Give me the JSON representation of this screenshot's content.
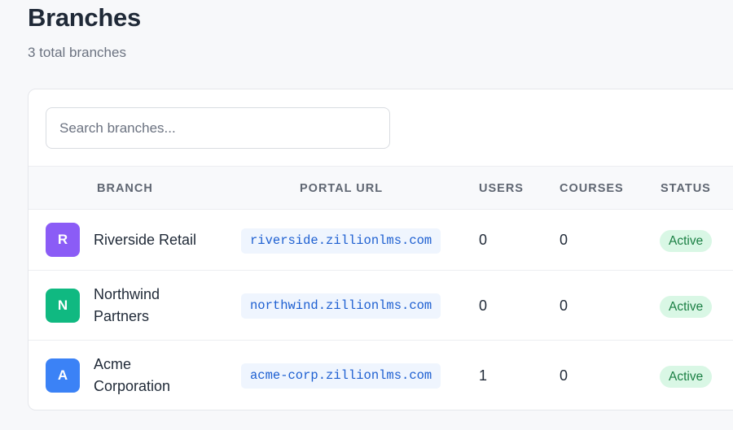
{
  "header": {
    "title": "Branches",
    "subtitle": "3 total branches"
  },
  "search": {
    "placeholder": "Search branches...",
    "value": ""
  },
  "table": {
    "columns": [
      "BRANCH",
      "PORTAL URL",
      "USERS",
      "COURSES",
      "STATUS"
    ],
    "rows": [
      {
        "initial": "R",
        "name": "Riverside Retail",
        "url": "riverside.zillionlms.com",
        "users": "0",
        "courses": "0",
        "status": "Active",
        "color": "#8b5cf6"
      },
      {
        "initial": "N",
        "name": "Northwind Partners",
        "url": "northwind.zillionlms.com",
        "users": "0",
        "courses": "0",
        "status": "Active",
        "color": "#10b981"
      },
      {
        "initial": "A",
        "name": "Acme Corporation",
        "url": "acme-corp.zillionlms.com",
        "users": "1",
        "courses": "0",
        "status": "Active",
        "color": "#3b82f6"
      }
    ]
  },
  "colors": {
    "status_active_bg": "#d9f7e5",
    "status_active_text": "#1a7f43",
    "url_text": "#1d5fd1"
  }
}
